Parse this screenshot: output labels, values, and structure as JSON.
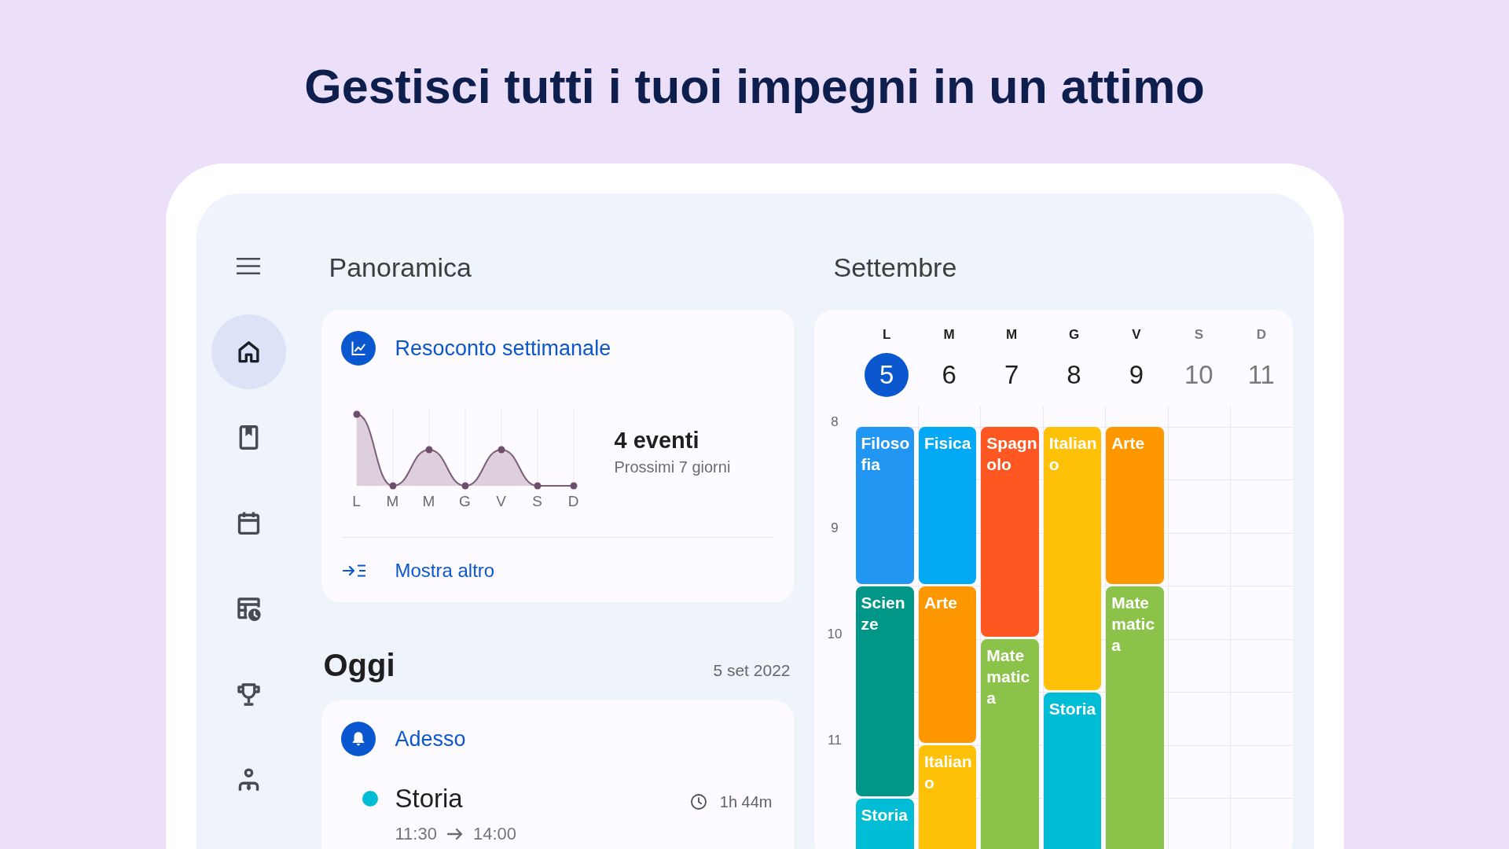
{
  "headline": "Gestisci tutti i tuoi impegni in un attimo",
  "sidebar": {
    "nav": [
      {
        "selected": true
      },
      {
        "selected": false
      },
      {
        "selected": false
      },
      {
        "selected": false
      },
      {
        "selected": false
      },
      {
        "selected": false
      }
    ]
  },
  "overview": {
    "title": "Panoramica",
    "weekly_card": {
      "title": "Resoconto settimanale",
      "chart_days": [
        "L",
        "M",
        "M",
        "G",
        "V",
        "S",
        "D"
      ],
      "count": "4 eventi",
      "subtitle": "Prossimi 7 giorni",
      "link": "Mostra altro"
    }
  },
  "today": {
    "title": "Oggi",
    "date": "5 set 2022",
    "card": {
      "title": "Adesso",
      "events": [
        {
          "title": "Storia",
          "color": "#00bcd4",
          "duration": "1h 44m",
          "start": "11:30",
          "end": "14:00"
        }
      ]
    }
  },
  "calendar": {
    "title": "Settembre",
    "hours": [
      "8",
      "9",
      "10",
      "11"
    ],
    "days": [
      {
        "letter": "L",
        "number": "5",
        "selected": true,
        "weekend": false,
        "slots": [
          {
            "kind": "event",
            "title": "Filosofia",
            "color": "#2196f3"
          },
          {
            "kind": "continued"
          },
          {
            "kind": "continued"
          },
          {
            "kind": "event",
            "title": "Scienze",
            "color": "#009688"
          },
          {
            "kind": "continued"
          },
          {
            "kind": "continued"
          },
          {
            "kind": "continued"
          },
          {
            "kind": "event",
            "title": "Storia",
            "color": "#00bcd4"
          }
        ]
      },
      {
        "letter": "M",
        "number": "6",
        "selected": false,
        "weekend": false,
        "slots": [
          {
            "kind": "event",
            "title": "Fisica",
            "color": "#03a9f4"
          },
          {
            "kind": "continued"
          },
          {
            "kind": "continued"
          },
          {
            "kind": "event",
            "title": "Arte",
            "color": "#ff9800"
          },
          {
            "kind": "continued"
          },
          {
            "kind": "continued"
          },
          {
            "kind": "event",
            "title": "Italiano",
            "color": "#ffc107"
          },
          {
            "kind": "continued"
          }
        ]
      },
      {
        "letter": "M",
        "number": "7",
        "selected": false,
        "weekend": false,
        "slots": [
          {
            "kind": "event",
            "title": "Spagnolo",
            "color": "#ff5722"
          },
          {
            "kind": "continued"
          },
          {
            "kind": "continued"
          },
          {
            "kind": "continued"
          },
          {
            "kind": "event",
            "title": "Matematica",
            "color": "#8bc34a"
          },
          {
            "kind": "continued"
          },
          {
            "kind": "continued"
          },
          {
            "kind": "continued"
          }
        ]
      },
      {
        "letter": "G",
        "number": "8",
        "selected": false,
        "weekend": false,
        "slots": [
          {
            "kind": "event",
            "title": "Italiano",
            "color": "#ffc107"
          },
          {
            "kind": "continued"
          },
          {
            "kind": "continued"
          },
          {
            "kind": "continued"
          },
          {
            "kind": "continued"
          },
          {
            "kind": "event",
            "title": "Storia",
            "color": "#00bcd4"
          },
          {
            "kind": "continued"
          },
          {
            "kind": "continued"
          }
        ]
      },
      {
        "letter": "V",
        "number": "9",
        "selected": false,
        "weekend": false,
        "slots": [
          {
            "kind": "event",
            "title": "Arte",
            "color": "#ff9800"
          },
          {
            "kind": "continued"
          },
          {
            "kind": "continued"
          },
          {
            "kind": "event",
            "title": "Matematica",
            "color": "#8bc34a"
          },
          {
            "kind": "continued"
          },
          {
            "kind": "continued"
          },
          {
            "kind": "continued"
          },
          {
            "kind": "continued"
          }
        ]
      },
      {
        "letter": "S",
        "number": "10",
        "selected": false,
        "weekend": true
      },
      {
        "letter": "D",
        "number": "11",
        "selected": false,
        "weekend": true
      }
    ]
  }
}
